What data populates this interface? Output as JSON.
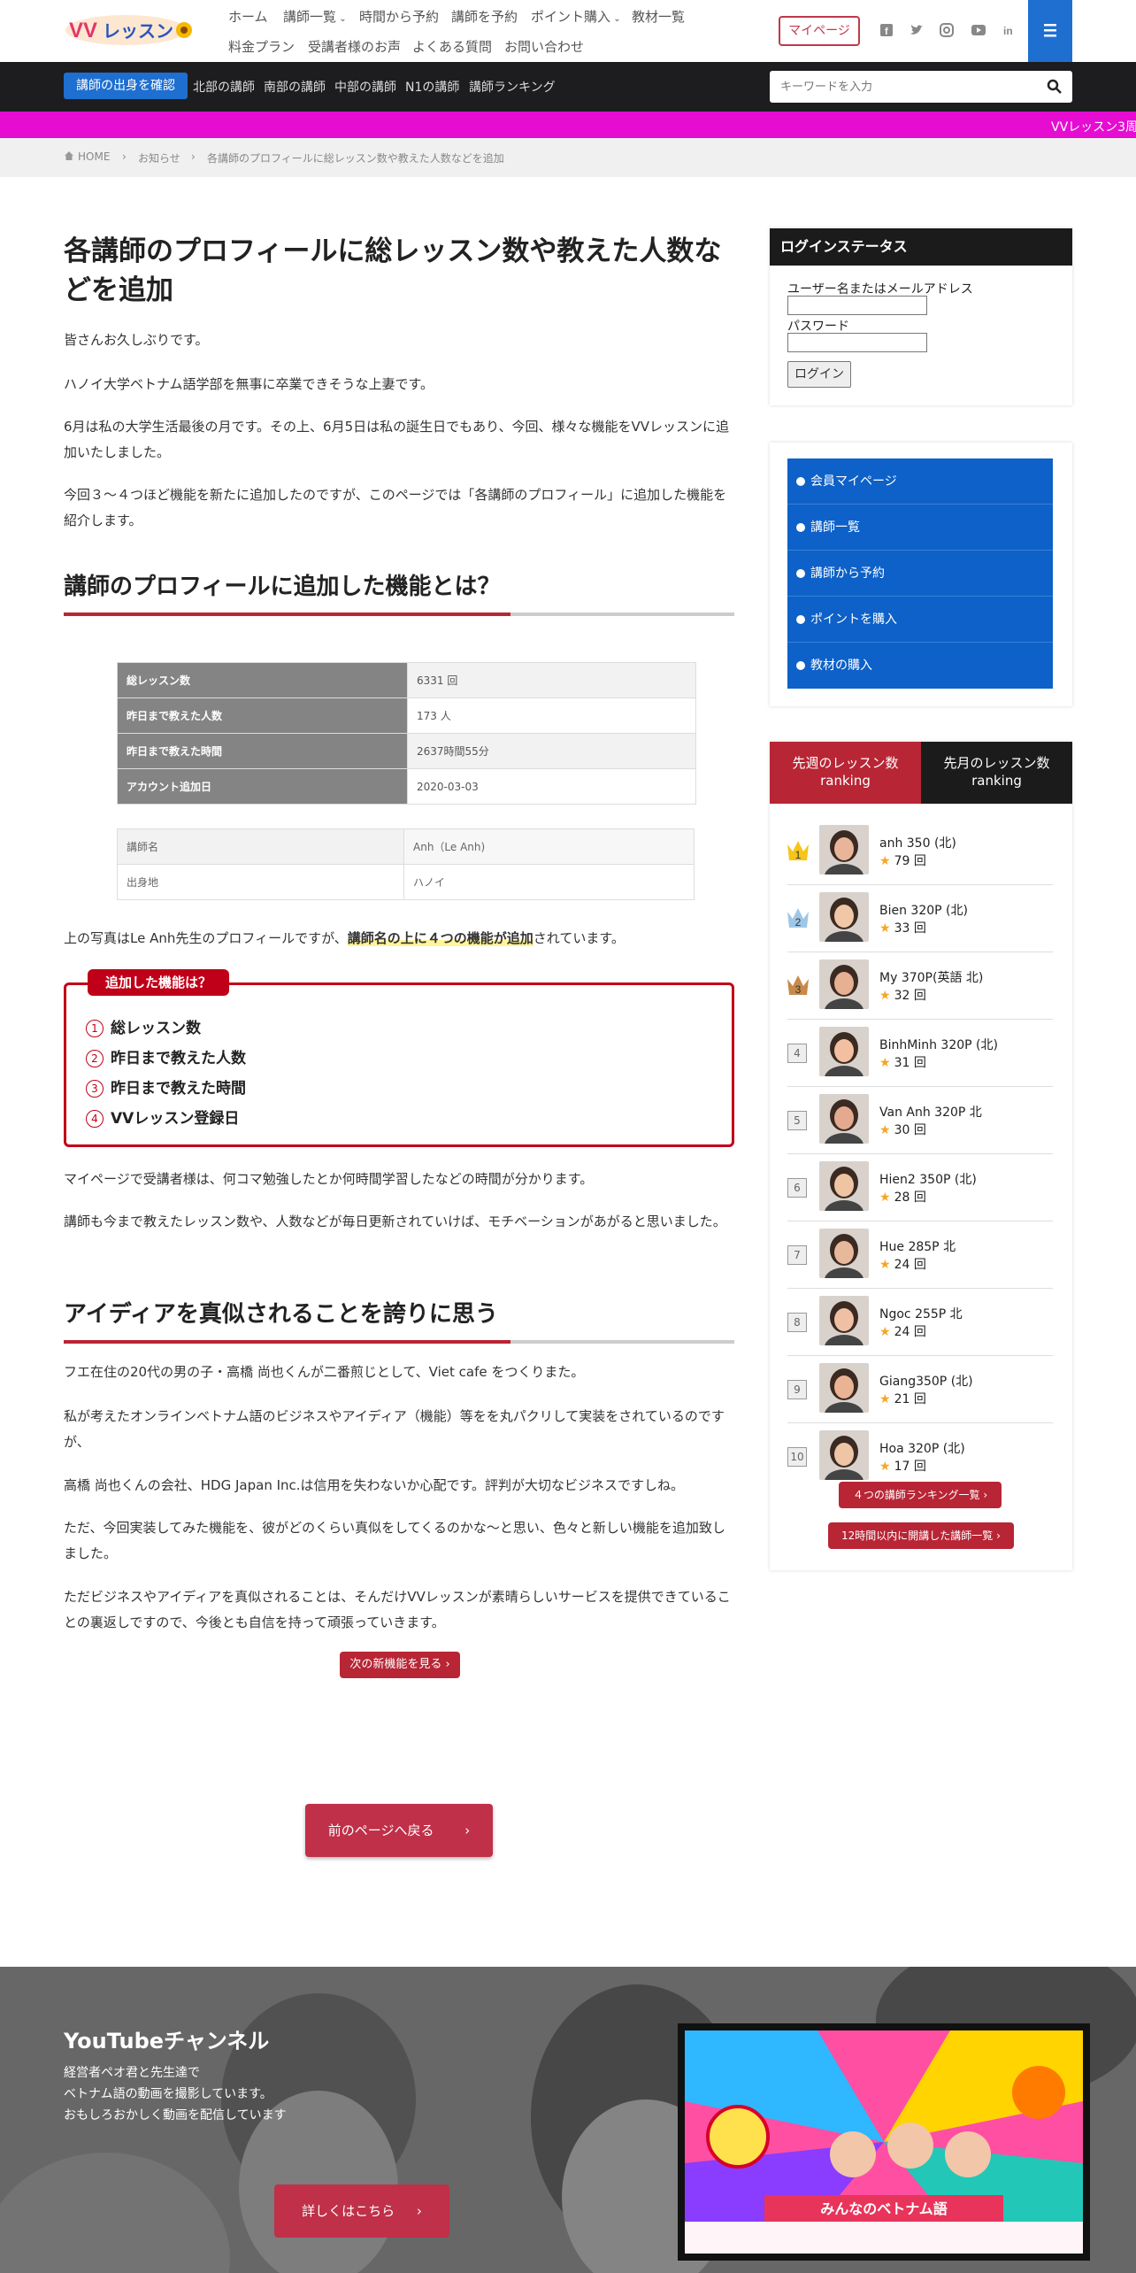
{
  "header": {
    "nav_row1": [
      "ホーム",
      "講師一覧",
      "時間から予約",
      "講師を予約",
      "ポイント購入",
      "教材一覧"
    ],
    "nav_row2": [
      "料金プラン",
      "受講者様のお声",
      "よくある質問",
      "お問い合わせ"
    ],
    "mypage_label": "マイページ"
  },
  "subnav": {
    "confirm_label": "講師の出身を確認",
    "items": [
      "北部の講師",
      "南部の講師",
      "中部の講師",
      "N1の講師",
      "講師ランキング"
    ],
    "search_placeholder": "キーワードを入力"
  },
  "marquee": "VVレッスン3周",
  "breadcrumb": [
    "HOME",
    "お知らせ",
    "各講師のプロフィールに総レッスン数や教えた人数などを追加"
  ],
  "article": {
    "title": "各講師のプロフィールに総レッスン数や教えた人数などを追加",
    "p1": "皆さんお久しぶりです。",
    "p2": "ハノイ大学ベトナム語学部を無事に卒業できそうな上妻です。",
    "p3": "6月は私の大学生活最後の月です。その上、6月5日は私の誕生日でもあり、今回、様々な機能をVVレッスンに追加いたしました。",
    "p4": "今回３〜４つほど機能を新たに追加したのですが、このページでは「各講師のプロフィール」に追加した機能を紹介します。",
    "h2a": "講師のプロフィールに追加した機能とは？",
    "profile_rows": [
      {
        "k": "総レッスン数",
        "v": "6331 回"
      },
      {
        "k": "昨日まで教えた人数",
        "v": "173 人"
      },
      {
        "k": "昨日まで教えた時間",
        "v": "2637時間55分"
      },
      {
        "k": "アカウント追加日",
        "v": "2020-03-03"
      }
    ],
    "profile_rows2": [
      {
        "k": "講師名",
        "v": "Anh（Le Anh)"
      },
      {
        "k": "出身地",
        "v": "ハノイ"
      }
    ],
    "p5_pre": "上の写真はLe Anh先生のプロフィールですが、",
    "p5_bold": "講師名の上に４つの機能が追加",
    "p5_post": "されています。",
    "feature_label": "追加した機能は？",
    "features": [
      "総レッスン数",
      "昨日まで教えた人数",
      "昨日まで教えた時間",
      "VVレッスン登録日"
    ],
    "feature_nums": [
      "1",
      "2",
      "3",
      "4"
    ],
    "p6": "マイページで受講者様は、何コマ勉強したとか何時間学習したなどの時間が分かります。",
    "p7": "講師も今まで教えたレッスン数や、人数などが毎日更新されていけば、モチベーションがあがると思いました。",
    "h2b": "アイディアを真似されることを誇りに思う",
    "p8": "フエ在住の20代の男の子・高橋 尚也くんが二番煎じとして、Viet cafe をつくりまた。",
    "p9": "私が考えたオンラインベトナム語のビジネスやアイディア（機能）等をを丸パクリして実装をされているのですが、",
    "p10": "高橋 尚也くんの会社、HDG Japan Inc.は信用を失わないか心配です。評判が大切なビジネスですしね。",
    "p11": "ただ、今回実装してみた機能を、彼がどのくらい真似をしてくるのかな〜と思い、色々と新しい機能を追加致しました。",
    "p12": "ただビジネスやアイディアを真似されることは、そんだけVVレッスンが素晴らしいサービスを提供できていることの裏返しですので、今後とも自信を持って頑張っていきます。",
    "next_label": "次の新機能を見る",
    "prev_label": "前のページへ戻る"
  },
  "sidebar": {
    "login_title": "ログインステータス",
    "user_label": "ユーザー名またはメールアドレス",
    "pass_label": "パスワード",
    "login_label": "ログイン",
    "menu": [
      "会員マイページ",
      "講師一覧",
      "講師から予約",
      "ポイントを購入",
      "教材の購入"
    ],
    "tab1": "先週のレッスン数\nranking",
    "tab1_a": "先週のレッスン数",
    "tab1_b": "ranking",
    "tab2_a": "先月のレッスン数",
    "tab2_b": "ranking",
    "ranking": [
      {
        "rank": "1",
        "name": "anh 350 (北)",
        "count": "79 回"
      },
      {
        "rank": "2",
        "name": "Bien 320P (北)",
        "count": "33 回"
      },
      {
        "rank": "3",
        "name": "My 370P(英語 北)",
        "count": "32 回"
      },
      {
        "rank": "4",
        "name": "BinhMinh 320P (北)",
        "count": "31 回"
      },
      {
        "rank": "5",
        "name": "Van Anh 320P 北",
        "count": "30 回"
      },
      {
        "rank": "6",
        "name": "Hien2 350P (北)",
        "count": "28 回"
      },
      {
        "rank": "7",
        "name": "Hue 285P 北",
        "count": "24 回"
      },
      {
        "rank": "8",
        "name": "Ngoc 255P 北",
        "count": "24 回"
      },
      {
        "rank": "9",
        "name": "Giang350P (北)",
        "count": "21 回"
      },
      {
        "rank": "10",
        "name": "Hoa 320P (北)",
        "count": "17 回"
      }
    ],
    "btn1": "４つの講師ランキング一覧",
    "btn2": "12時間以内に開講した講師一覧"
  },
  "youtube": {
    "title": "YouTubeチャンネル",
    "desc1": "経営者ペオ君と先生達で",
    "desc2": "ベトナム語の動画を撮影しています。",
    "desc3": "おもしろおかしく動画を配信しています",
    "btn": "詳しくはこちら",
    "thumb_text": "みんなのベトナム語"
  },
  "colors": {
    "accent": "#b82535",
    "blue": "#1e6fd0",
    "dark": "#1b1b1c",
    "magenta": "#e60cd2"
  }
}
